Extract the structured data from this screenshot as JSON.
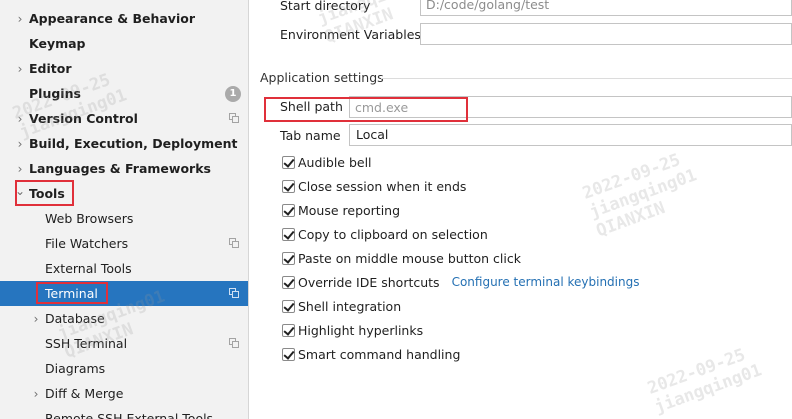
{
  "sidebar": {
    "items": [
      {
        "label": "Appearance & Behavior",
        "arrow": "›",
        "bold": true
      },
      {
        "label": "Keymap",
        "bold": true
      },
      {
        "label": "Editor",
        "arrow": "›",
        "bold": true
      },
      {
        "label": "Plugins",
        "bold": true,
        "badge": "1"
      },
      {
        "label": "Version Control",
        "arrow": "›",
        "bold": true,
        "copy_icon": true
      },
      {
        "label": "Build, Execution, Deployment",
        "arrow": "›",
        "bold": true
      },
      {
        "label": "Languages & Frameworks",
        "arrow": "›",
        "bold": true
      },
      {
        "label": "Tools",
        "arrow": "⌄",
        "bold": true
      },
      {
        "label": "Web Browsers"
      },
      {
        "label": "File Watchers",
        "copy_icon": true
      },
      {
        "label": "External Tools"
      },
      {
        "label": "Terminal",
        "selected": true,
        "copy_icon": true
      },
      {
        "label": "Database",
        "arrow": "›"
      },
      {
        "label": "SSH Terminal",
        "copy_icon": true
      },
      {
        "label": "Diagrams"
      },
      {
        "label": "Diff & Merge",
        "arrow": "›"
      },
      {
        "label": "Remote SSH External Tools"
      }
    ]
  },
  "main": {
    "start_directory_label": "Start directory",
    "start_directory_value": "D:/code/golang/test",
    "env_vars_label": "Environment Variables",
    "env_vars_value": "",
    "app_settings_title": "Application settings",
    "shell_path_label": "Shell path",
    "shell_path_placeholder": "cmd.exe",
    "tab_name_label": "Tab name",
    "tab_name_value": "Local",
    "checkboxes": [
      {
        "label": "Audible bell",
        "checked": true
      },
      {
        "label": "Close session when it ends",
        "checked": true
      },
      {
        "label": "Mouse reporting",
        "checked": true
      },
      {
        "label": "Copy to clipboard on selection",
        "checked": true
      },
      {
        "label": "Paste on middle mouse button click",
        "checked": true
      },
      {
        "label": "Override IDE shortcuts",
        "checked": true,
        "link": "Configure terminal keybindings"
      },
      {
        "label": "Shell integration",
        "checked": true
      },
      {
        "label": "Highlight hyperlinks",
        "checked": true
      },
      {
        "label": "Smart command handling",
        "checked": true
      }
    ]
  },
  "watermark": {
    "date": "2022-09-25",
    "user": "jiangqing01",
    "org": "QIANXIN"
  },
  "colors": {
    "selection": "#2675bf",
    "highlight_box": "#e0303a",
    "link": "#2470b3"
  }
}
